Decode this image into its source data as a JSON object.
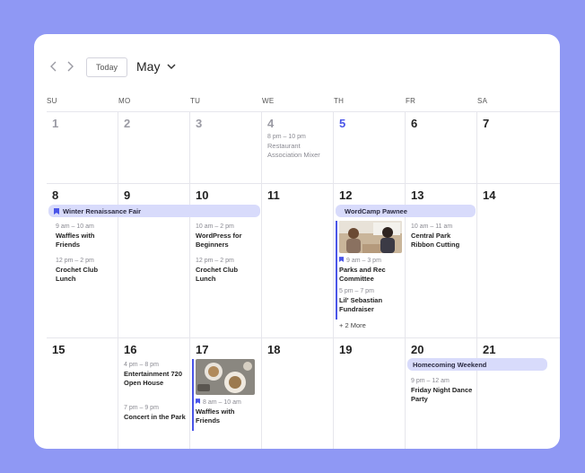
{
  "toolbar": {
    "today_label": "Today",
    "month_label": "May"
  },
  "weekdays": [
    "SU",
    "MO",
    "TU",
    "WE",
    "TH",
    "FR",
    "SA"
  ],
  "weeks": [
    {
      "days": [
        "1",
        "2",
        "3",
        "4",
        "5",
        "6",
        "7"
      ]
    },
    {
      "days": [
        "8",
        "9",
        "10",
        "11",
        "12",
        "13",
        "14"
      ]
    },
    {
      "days": [
        "15",
        "16",
        "17",
        "18",
        "19",
        "20",
        "21"
      ]
    }
  ],
  "banners": {
    "winter_fair": "Winter Renaissance Fair",
    "wordcamp": "WordCamp Pawnee",
    "homecoming": "Homecoming Weekend"
  },
  "events": {
    "d4": {
      "time": "8 pm – 10 pm",
      "title": "Restaurant Association Mixer"
    },
    "d8a": {
      "time": "9 am – 10 am",
      "title": "Waffles with Friends"
    },
    "d8b": {
      "time": "12 pm – 2 pm",
      "title": "Crochet Club Lunch"
    },
    "d10a": {
      "time": "10 am – 2 pm",
      "title": "WordPress for Beginners"
    },
    "d10b": {
      "time": "12 pm – 2 pm",
      "title": "Crochet Club Lunch"
    },
    "d12a": {
      "time": "9 am – 3 pm",
      "title": "Parks and Rec Committee"
    },
    "d12b": {
      "time": "5 pm – 7 pm",
      "title": "Lil' Sebastian Fundraiser"
    },
    "d12more": "+ 2 More",
    "d13": {
      "time": "10 am – 11 am",
      "title": "Central Park Ribbon Cutting"
    },
    "d16a": {
      "time": "4 pm – 8 pm",
      "title": "Entertainment 720 Open House"
    },
    "d16b": {
      "time": "7 pm – 9 pm",
      "title": "Concert in the Park"
    },
    "d17": {
      "time": "8 am – 10 am",
      "title": "Waffles with Friends"
    },
    "d20": {
      "time": "9 pm – 12 am",
      "title": "Friday Night Dance Party"
    }
  },
  "colors": {
    "background": "#8f98f4",
    "accent": "#4a55e8",
    "banner": "#d8dbfb"
  },
  "icons": {
    "prev": "chevron-left-icon",
    "next": "chevron-right-icon",
    "dropdown": "chevron-down-icon",
    "bookmark": "bookmark-icon"
  }
}
